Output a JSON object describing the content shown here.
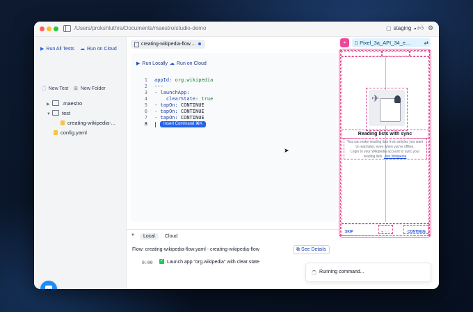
{
  "window": {
    "path": "/Users/prokshluthra/Documents/maestro/studio-demo",
    "device_selector": "staging",
    "traffic_lights": [
      "#ff5f57",
      "#febc2e",
      "#28c840"
    ]
  },
  "sidebar": {
    "run_all_tests": "Run All Tests",
    "run_on_cloud": "Run on Cloud",
    "new_test": "New Test",
    "new_folder": "New Folder",
    "tree": [
      {
        "label": ".maestro",
        "type": "folder"
      },
      {
        "label": "test",
        "type": "folder",
        "expanded": true
      },
      {
        "label": "creating-wikipedia-...",
        "type": "file"
      },
      {
        "label": "config.yaml",
        "type": "file"
      }
    ]
  },
  "editor": {
    "tab_name": "creating-wikipedia-flow....",
    "run_locally": "Run Locally",
    "run_on_cloud": "Run on Cloud",
    "lines": [
      {
        "n": "1",
        "key": "appId:",
        "value": " org.wikipedia"
      },
      {
        "n": "2",
        "text": "---"
      },
      {
        "n": "3",
        "key": "- launchApp:",
        "value": ""
      },
      {
        "n": "4",
        "key": "    clearState:",
        "value": " true"
      },
      {
        "n": "5",
        "key": "- tapOn:",
        "value": " CONTINUE"
      },
      {
        "n": "6",
        "key": "- tapOn:",
        "value": " CONTINUE"
      },
      {
        "n": "7",
        "key": "- tapOn:",
        "value": " CONTINUE"
      },
      {
        "n": "8",
        "text": ""
      }
    ],
    "insert_chip": "Insert Command ⌘K"
  },
  "bottom": {
    "tabs": [
      "Local",
      "Cloud"
    ],
    "flow_label": "Flow: creating-wikipedia-flow.yaml - creating-wikipedia-flow",
    "see_details": "See Details",
    "step_time": "0:00",
    "step_label": "Launch app \"org.wikipedia\" with clear state"
  },
  "device": {
    "name": "Pixel_3a_API_34_e...",
    "screen": {
      "title": "Reading lists with sync",
      "body_lines": [
        "You can make reading lists from articles you want",
        "to read later, even when you're offline.",
        "Login to your Wikipedia account to sync your",
        "reading lists."
      ],
      "link": "Join Wikipedia",
      "skip": "SKIP",
      "continue": "CONTINUE"
    }
  },
  "toast": {
    "label": "Running command..."
  },
  "colors": {
    "accent": "#2563eb",
    "inspector": "#ec4899"
  }
}
